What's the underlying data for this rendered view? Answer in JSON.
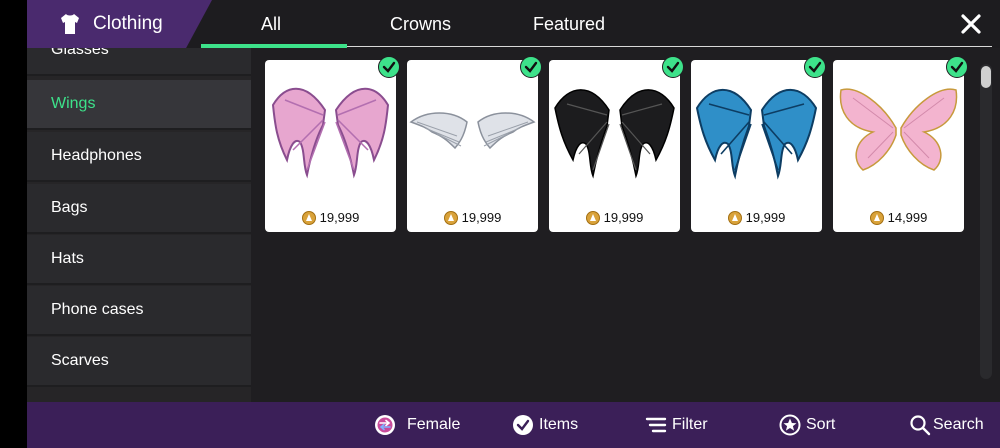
{
  "header": {
    "title": "Clothing",
    "tabs": [
      {
        "label": "All",
        "active": true
      },
      {
        "label": "Crowns",
        "active": false
      },
      {
        "label": "Featured",
        "active": false
      }
    ]
  },
  "sidebar": {
    "items": [
      {
        "label": "Glasses"
      },
      {
        "label": "Wings",
        "active": true
      },
      {
        "label": "Headphones"
      },
      {
        "label": "Bags"
      },
      {
        "label": "Hats"
      },
      {
        "label": "Phone cases"
      },
      {
        "label": "Scarves"
      }
    ]
  },
  "items": [
    {
      "price": "19,999",
      "owned": true,
      "kind": "pink-bat-wings"
    },
    {
      "price": "19,999",
      "owned": true,
      "kind": "silver-angel-wings"
    },
    {
      "price": "19,999",
      "owned": true,
      "kind": "black-bat-wings"
    },
    {
      "price": "19,999",
      "owned": true,
      "kind": "blue-bat-wings"
    },
    {
      "price": "14,999",
      "owned": true,
      "kind": "pink-fairy-wings"
    }
  ],
  "bottom_bar": {
    "female": "Female",
    "items": "Items",
    "filter": "Filter",
    "sort": "Sort",
    "search": "Search"
  },
  "colors": {
    "accent": "#3de28a",
    "brand_purple": "#4a2a6e",
    "bottom_bar_purple": "#3b1f58",
    "background": "#1f1e21"
  }
}
